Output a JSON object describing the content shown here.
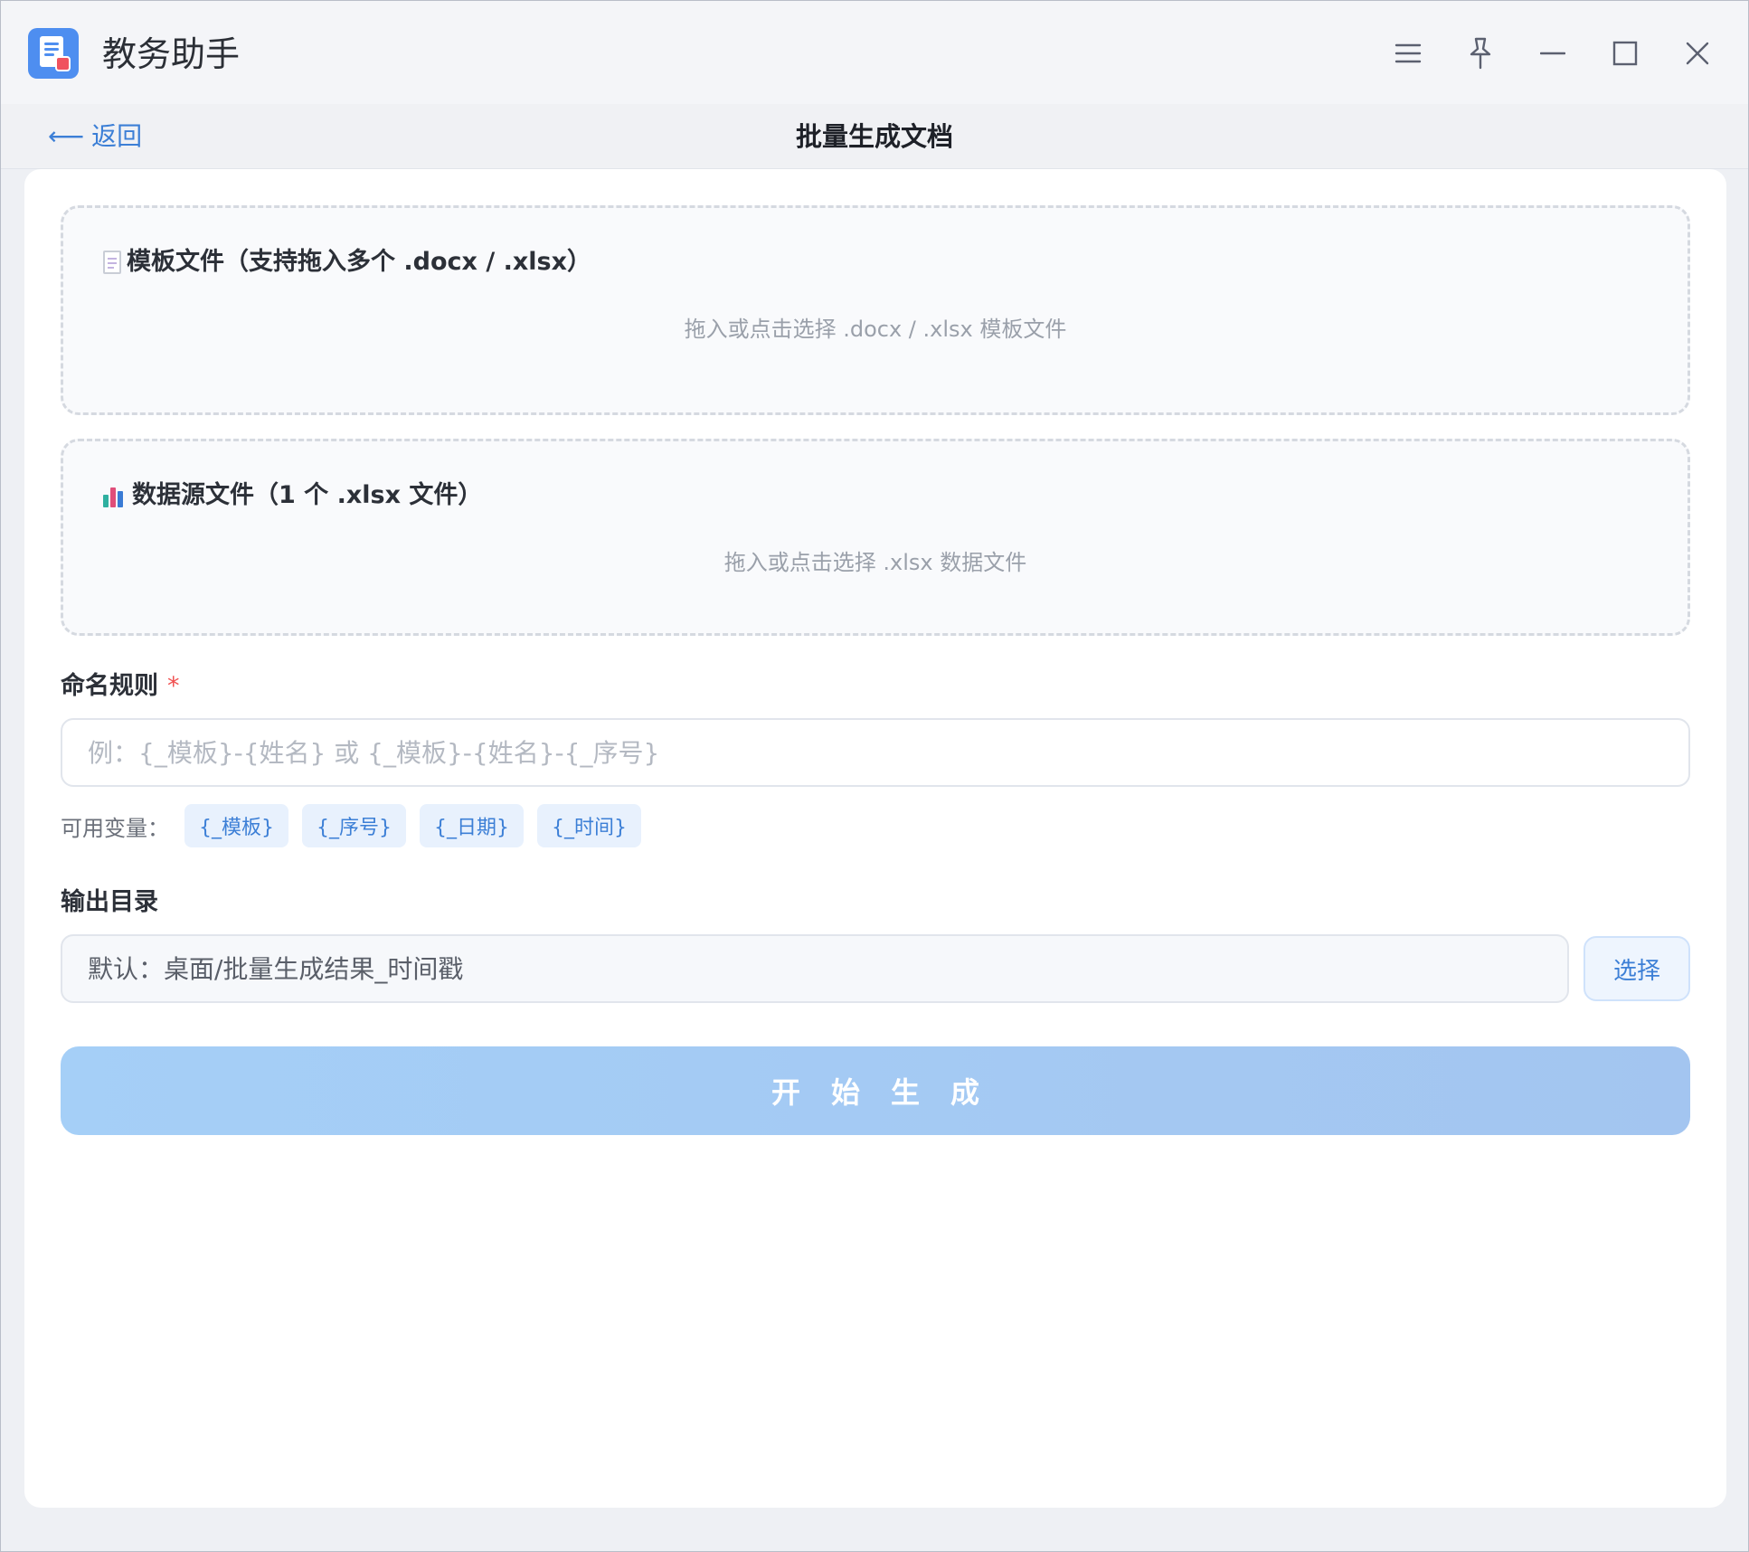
{
  "window": {
    "title": "教务助手",
    "controls": {
      "menu": "menu-icon",
      "pin": "pin-icon",
      "minimize": "minimize-icon",
      "maximize": "maximize-icon",
      "close": "close-icon"
    }
  },
  "nav": {
    "back_label": "返回",
    "back_arrow": "⟵",
    "page_title": "批量生成文档"
  },
  "template_zone": {
    "title": "模板文件（支持拖入多个 .docx / .xlsx）",
    "hint": "拖入或点击选择 .docx / .xlsx 模板文件",
    "icon": "document-icon"
  },
  "data_zone": {
    "title": "数据源文件（1 个 .xlsx 文件）",
    "hint": "拖入或点击选择 .xlsx 数据文件",
    "icon": "bar-chart-icon"
  },
  "naming": {
    "label": "命名规则",
    "required_mark": "*",
    "placeholder": "例：{_模板}-{姓名} 或 {_模板}-{姓名}-{_序号}",
    "vars_label": "可用变量：",
    "vars": [
      "{_模板}",
      "{_序号}",
      "{_日期}",
      "{_时间}"
    ]
  },
  "output": {
    "label": "输出目录",
    "placeholder": "默认：桌面/批量生成结果_时间戳",
    "select_label": "选择"
  },
  "start_button": "开始生成",
  "colors": {
    "accent": "#3c7fd6",
    "start_button": "#a5cff7",
    "required": "#f05252"
  }
}
